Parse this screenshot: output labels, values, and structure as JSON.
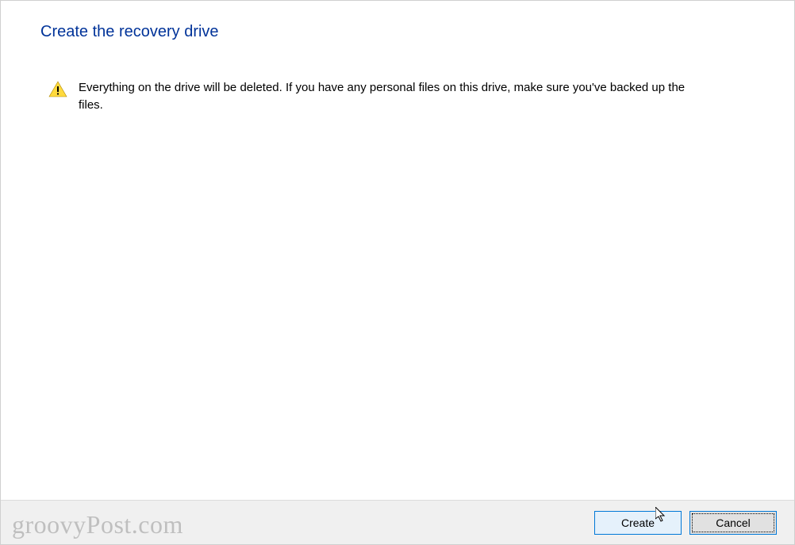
{
  "dialog": {
    "title": "Create the recovery drive",
    "warning_message": "Everything on the drive will be deleted. If you have any personal files on this drive, make sure you've backed up the files."
  },
  "buttons": {
    "create_label": "Create",
    "cancel_label": "Cancel"
  },
  "watermark": "groovyPost.com"
}
